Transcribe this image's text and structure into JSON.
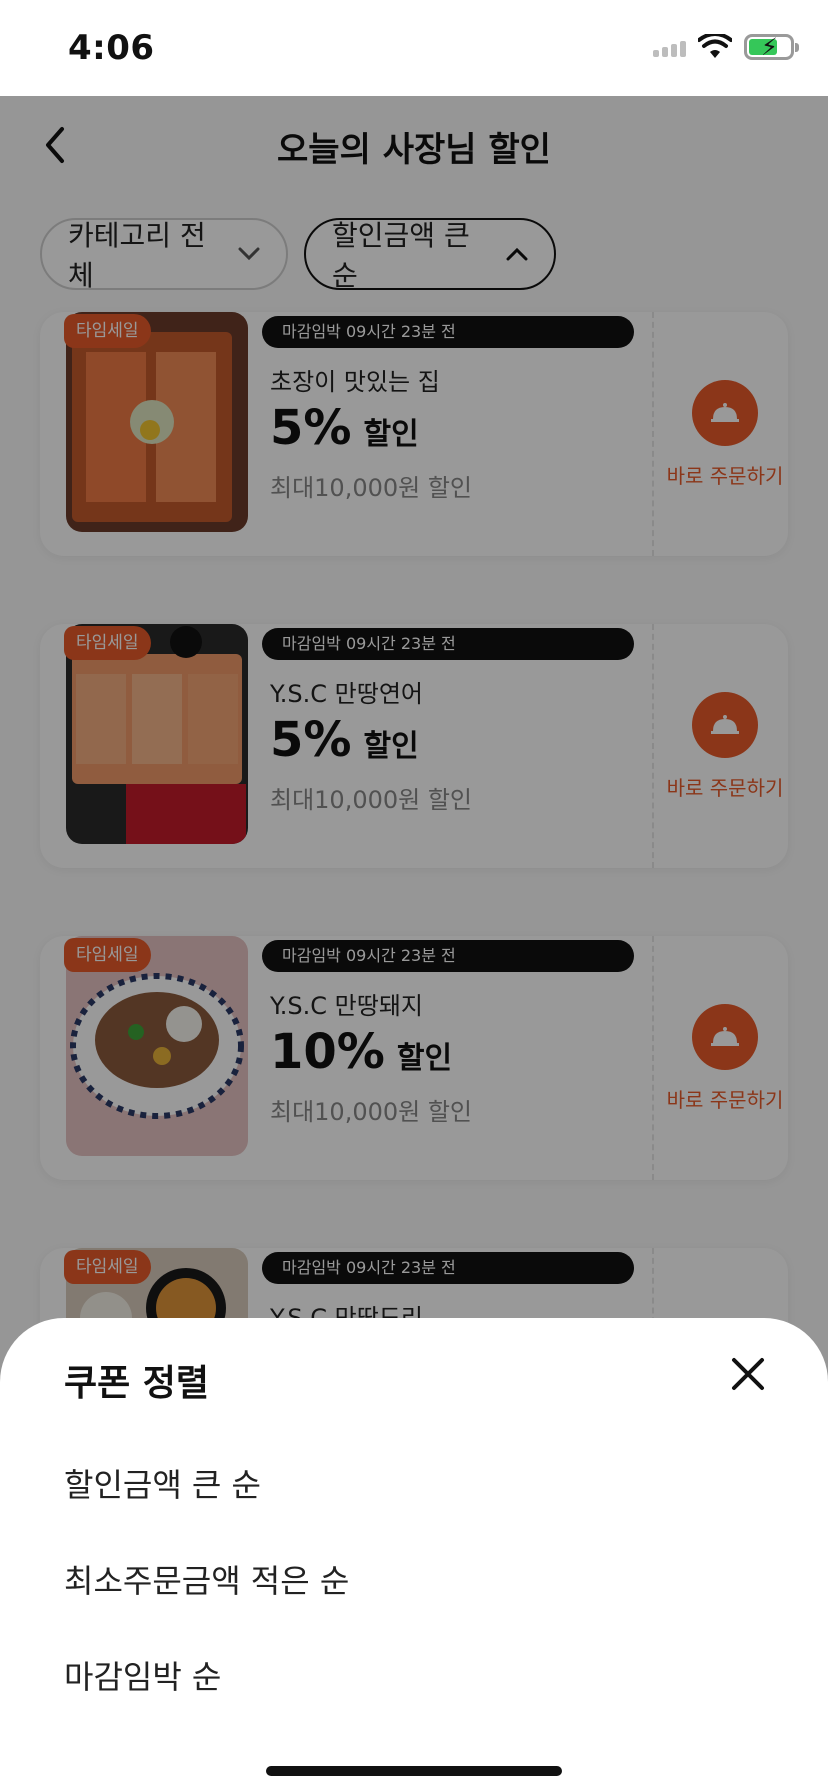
{
  "status": {
    "time": "4:06"
  },
  "header": {
    "title": "오늘의 사장님 할인"
  },
  "filters": {
    "category": "카테고리 전체",
    "sort": "할인금액 큰 순"
  },
  "coupons": [
    {
      "badge": "타임세일",
      "deadline": "마감임박 09시간 23분 전",
      "shop": "초장이 맛있는 집",
      "percent": "5%",
      "unit": "할인",
      "max": "최대10,000원 할인",
      "order": "바로 주문하기"
    },
    {
      "badge": "타임세일",
      "deadline": "마감임박 09시간 23분 전",
      "shop": "Y.S.C 만땅연어",
      "percent": "5%",
      "unit": "할인",
      "max": "최대10,000원 할인",
      "order": "바로 주문하기"
    },
    {
      "badge": "타임세일",
      "deadline": "마감임박 09시간 23분 전",
      "shop": "Y.S.C 만땅돼지",
      "percent": "10%",
      "unit": "할인",
      "max": "최대10,000원 할인",
      "order": "바로 주문하기"
    },
    {
      "badge": "타임세일",
      "deadline": "마감임박 09시간 23분 전",
      "shop": "Y.S.C 만땅도리",
      "percent": "",
      "unit": "",
      "max": "",
      "order": ""
    }
  ],
  "sheet": {
    "title": "쿠폰 정렬",
    "options": [
      "할인금액 큰 순",
      "최소주문금액 적은 순",
      "마감임박 순"
    ]
  },
  "colors": {
    "accent": "#e85a2a",
    "overlay": "rgba(0,0,0,0.40)"
  },
  "icons": {
    "back": "chevron-left-icon",
    "dropdown": "chevron-down-icon",
    "dropup": "chevron-up-icon",
    "order": "cloche-icon",
    "close": "close-icon"
  }
}
